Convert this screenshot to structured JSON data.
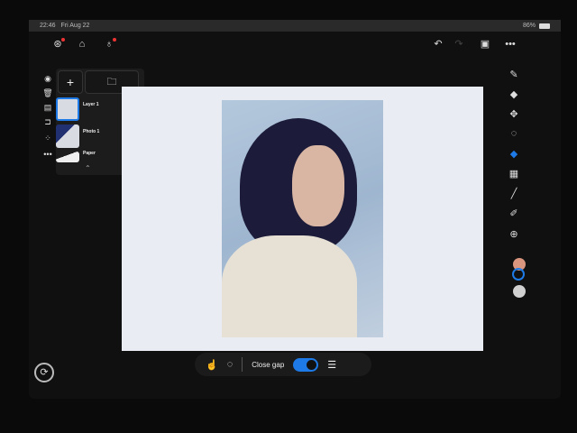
{
  "status": {
    "time": "22:46",
    "date": "Fri Aug 22",
    "battery": "86%"
  },
  "layers": {
    "items": [
      {
        "name": "Layer 1"
      },
      {
        "name": "Photo 1"
      },
      {
        "name": "Paper"
      }
    ]
  },
  "bottom_bar": {
    "close_gap_label": "Close gap",
    "close_gap_on": true
  },
  "colors": {
    "accent": "#1e7ae6",
    "primary_swatch": "#d9957e",
    "secondary_swatch": "#d0d0d0"
  }
}
